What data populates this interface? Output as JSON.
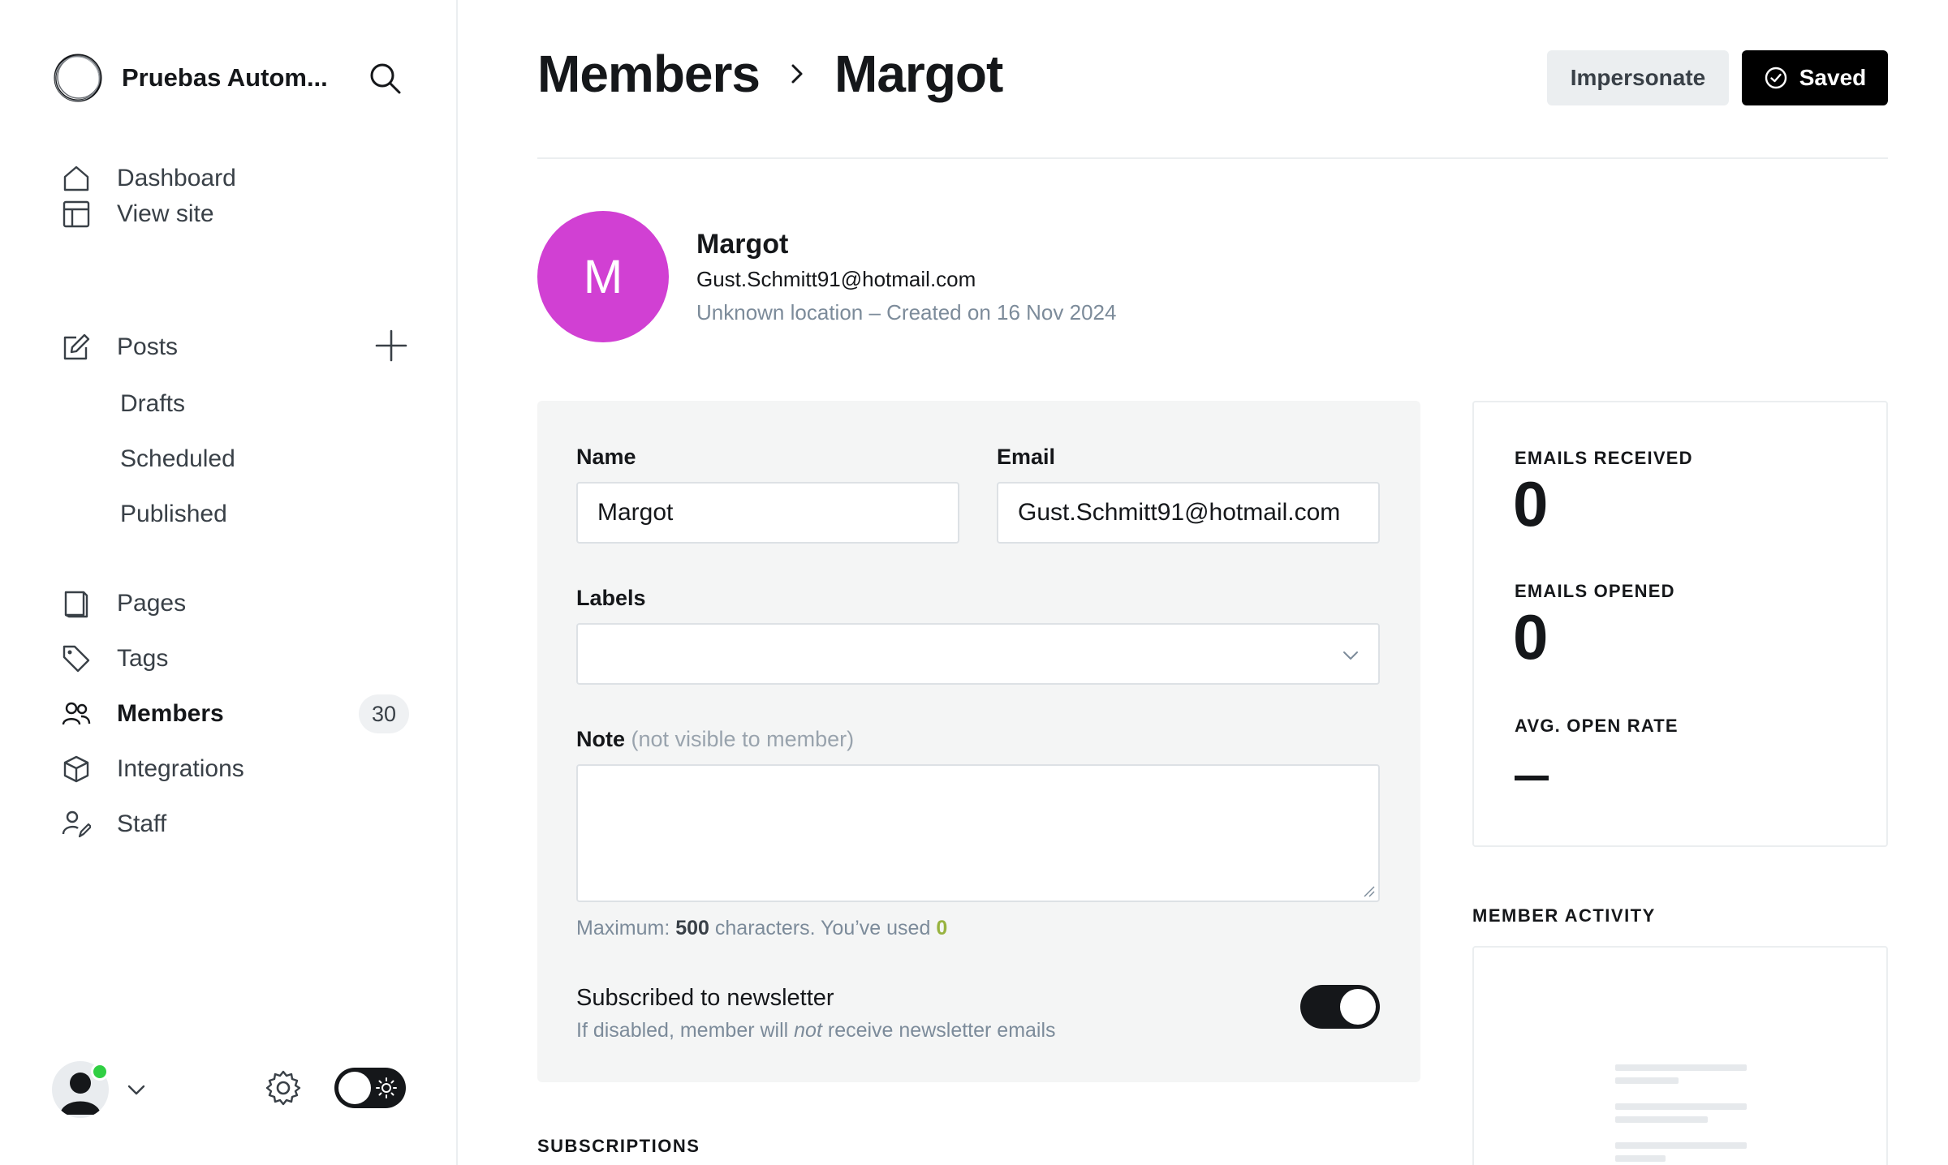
{
  "sidebar": {
    "site_name": "Pruebas Autom...",
    "nav_top": [
      {
        "label": "Dashboard"
      },
      {
        "label": "View site"
      }
    ],
    "posts": {
      "label": "Posts",
      "children": [
        {
          "label": "Drafts"
        },
        {
          "label": "Scheduled"
        },
        {
          "label": "Published"
        }
      ]
    },
    "nav_bottom": [
      {
        "label": "Pages"
      },
      {
        "label": "Tags"
      },
      {
        "label": "Members",
        "count": "30"
      },
      {
        "label": "Integrations"
      },
      {
        "label": "Staff"
      }
    ]
  },
  "header": {
    "breadcrumb_parent": "Members",
    "breadcrumb_current": "Margot",
    "impersonate_label": "Impersonate",
    "saved_label": "Saved"
  },
  "member": {
    "initial": "M",
    "avatar_color": "#d140d3",
    "name": "Margot",
    "email": "Gust.Schmitt91@hotmail.com",
    "meta": "Unknown location – Created on 16 Nov 2024"
  },
  "form": {
    "name_label": "Name",
    "name_value": "Margot",
    "email_label": "Email",
    "email_value": "Gust.Schmitt91@hotmail.com",
    "labels_label": "Labels",
    "labels_value": "",
    "note_label": "Note",
    "note_sublabel": "(not visible to member)",
    "note_value": "",
    "hint_prefix": "Maximum: ",
    "hint_max": "500",
    "hint_mid": " characters. You’ve used ",
    "hint_used": "0",
    "newsletter_title": "Subscribed to newsletter",
    "newsletter_desc_a": "If disabled, member will ",
    "newsletter_desc_em": "not",
    "newsletter_desc_b": " receive newsletter emails",
    "newsletter_enabled": true
  },
  "subscriptions_title": "SUBSCRIPTIONS",
  "stats": {
    "emails_received_label": "EMAILS RECEIVED",
    "emails_received_value": "0",
    "emails_opened_label": "EMAILS OPENED",
    "emails_opened_value": "0",
    "avg_open_rate_label": "AVG. OPEN RATE"
  },
  "activity_title": "MEMBER ACTIVITY",
  "colors": {
    "accent_green": "#30cf43",
    "primary_dark": "#15171a",
    "used_count_green": "#98b340"
  },
  "icons": [
    "ghost-logo-icon",
    "search-icon",
    "home-icon",
    "layout-icon",
    "edit-icon",
    "plus-icon",
    "page-icon",
    "tag-icon",
    "members-icon",
    "box-icon",
    "staff-icon",
    "chevron-down-icon",
    "gear-icon",
    "sun-icon",
    "chevron-right-icon",
    "check-circle-icon"
  ]
}
